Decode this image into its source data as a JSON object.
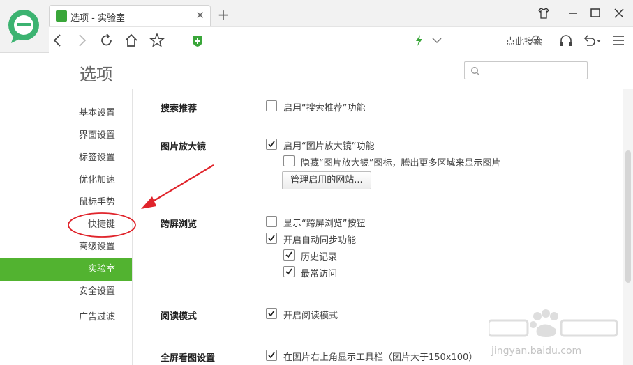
{
  "browser": {
    "tab_title": "选项 - 实验室",
    "tab_close": "✕",
    "new_tab": "+",
    "search_placeholder": "点此搜索"
  },
  "options": {
    "title": "选项"
  },
  "sidebar": {
    "items": [
      {
        "label": "基本设置"
      },
      {
        "label": "界面设置"
      },
      {
        "label": "标签设置"
      },
      {
        "label": "优化加速"
      },
      {
        "label": "鼠标手势"
      },
      {
        "label": "快捷键"
      },
      {
        "label": "高级设置"
      },
      {
        "label": "实验室"
      },
      {
        "label": "安全设置"
      },
      {
        "label": "广告过滤"
      }
    ],
    "active_index": 7
  },
  "sections": {
    "search_suggest": {
      "title": "搜索推荐",
      "opt1": {
        "label": "启用“搜索推荐”功能",
        "checked": false
      }
    },
    "image_magnifier": {
      "title": "图片放大镜",
      "opt1": {
        "label": "启用“图片放大镜”功能",
        "checked": true
      },
      "opt2": {
        "label": "隐藏“图片放大镜”图标，腾出更多区域来显示图片",
        "checked": false
      },
      "manage_button": "管理启用的网站..."
    },
    "cross_screen": {
      "title": "跨屏浏览",
      "opt1": {
        "label": "显示“跨屏浏览”按钮",
        "checked": false
      },
      "opt2": {
        "label": "开启自动同步功能",
        "checked": true
      },
      "opt3": {
        "label": "历史记录",
        "checked": true
      },
      "opt4": {
        "label": "最常访问",
        "checked": true
      }
    },
    "reading_mode": {
      "title": "阅读模式",
      "opt1": {
        "label": "开启阅读模式",
        "checked": true
      }
    },
    "fullscreen_image": {
      "title": "全屏看图设置",
      "opt1": {
        "label": "在图片右上角显示工具栏（图片大于150x100）",
        "checked": true
      }
    }
  },
  "watermark": {
    "url": "jingyan.baidu.com"
  },
  "colors": {
    "accent": "#52b330",
    "annotation": "#e0242b"
  }
}
